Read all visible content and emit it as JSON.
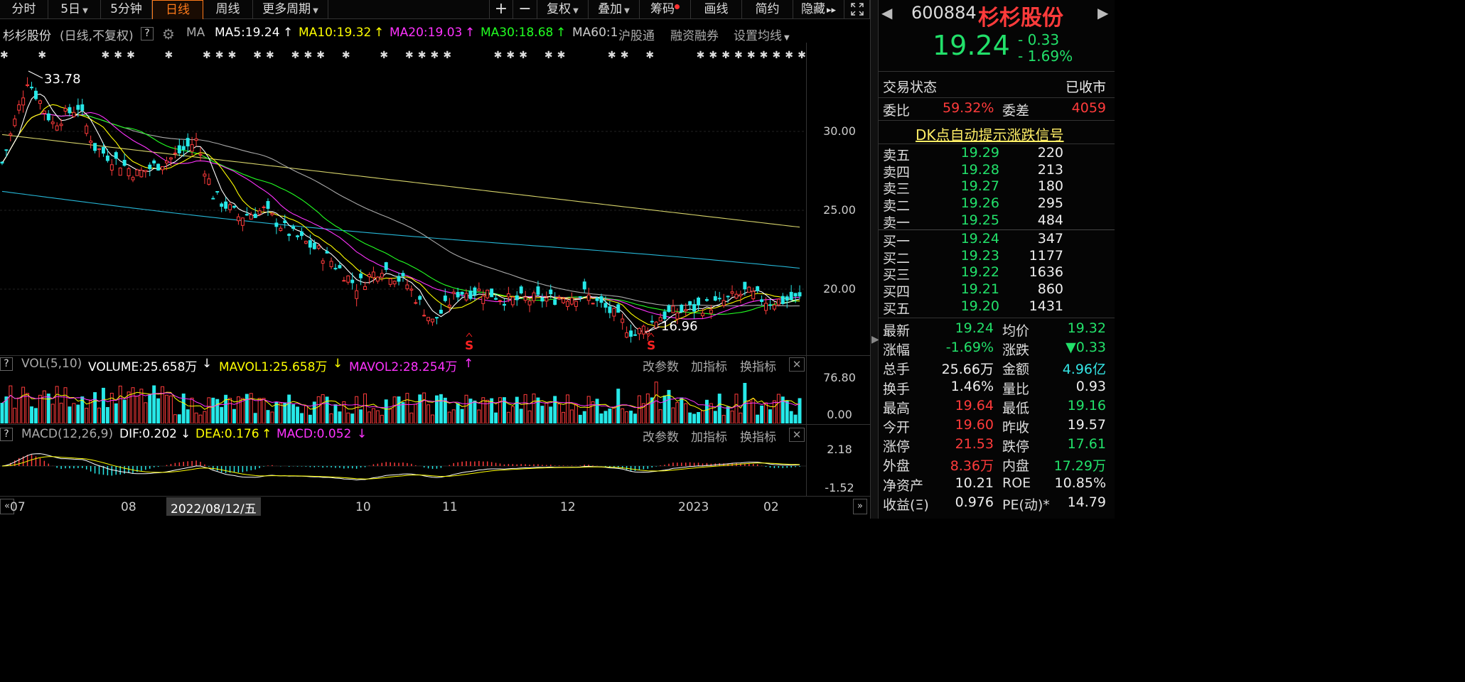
{
  "toolbar": {
    "tabs": [
      {
        "label": "分时"
      },
      {
        "label": "5日"
      },
      {
        "label": "5分钟"
      },
      {
        "label": "日线"
      },
      {
        "label": "周线"
      },
      {
        "label": "更多周期"
      }
    ],
    "right": [
      {
        "label": "+"
      },
      {
        "label": "−"
      },
      {
        "label": "复权"
      },
      {
        "label": "叠加"
      },
      {
        "label": "筹码"
      },
      {
        "label": "画线"
      },
      {
        "label": "简约"
      },
      {
        "label": "隐藏"
      }
    ]
  },
  "main_header": {
    "stock_name": "杉杉股份",
    "mode": "(日线,不复权)",
    "q": "?",
    "ma_label": "MA",
    "ma5": "MA5:19.24",
    "ma10": "MA10:19.32",
    "ma20": "MA20:19.03",
    "ma30": "MA30:18.68",
    "ma60": "MA60:1",
    "hgt": "沪股通",
    "rzrq": "融资融券",
    "set_ma": "设置均线"
  },
  "price_axis": [
    "30.00",
    "25.00",
    "20.00"
  ],
  "price_labels": {
    "high": "33.78",
    "low": "16.96",
    "signal": "S"
  },
  "vol_header": {
    "name": "VOL(5,10)",
    "volume": "VOLUME:25.658万",
    "mavol1": "MAVOL1:25.658万",
    "mavol2": "MAVOL2:28.254万"
  },
  "vol_axis": [
    "76.80",
    "0.00"
  ],
  "macd_header": {
    "name": "MACD(12,26,9)",
    "dif": "DIF:0.202",
    "dea": "DEA:0.176",
    "macd": "MACD:0.052"
  },
  "macd_axis": [
    "2.18",
    "-1.52"
  ],
  "panel_btns": {
    "edit": "改参数",
    "add": "加指标",
    "switch": "换指标"
  },
  "date_axis": {
    "labels": [
      "07",
      "08",
      "10",
      "11",
      "12",
      "2023",
      "02"
    ],
    "cursor_date": "2022/08/12/五"
  },
  "quote": {
    "code": "600884",
    "name": "杉杉股份",
    "price": "19.24",
    "change": "- 0.33",
    "pct": "- 1.69%",
    "status_label": "交易状态",
    "status_value": "已收市",
    "webi_label": "委比",
    "webi_value": "59.32%",
    "weicha_label": "委差",
    "weicha_value": "4059",
    "dk_link": "DK点自动提示涨跌信号",
    "asks": [
      {
        "label": "卖五",
        "price": "19.29",
        "vol": "220"
      },
      {
        "label": "卖四",
        "price": "19.28",
        "vol": "213"
      },
      {
        "label": "卖三",
        "price": "19.27",
        "vol": "180"
      },
      {
        "label": "卖二",
        "price": "19.26",
        "vol": "295"
      },
      {
        "label": "卖一",
        "price": "19.25",
        "vol": "484"
      }
    ],
    "bids": [
      {
        "label": "买一",
        "price": "19.24",
        "vol": "347"
      },
      {
        "label": "买二",
        "price": "19.23",
        "vol": "1177"
      },
      {
        "label": "买三",
        "price": "19.22",
        "vol": "1636"
      },
      {
        "label": "买四",
        "price": "19.21",
        "vol": "860"
      },
      {
        "label": "买五",
        "price": "19.20",
        "vol": "1431"
      }
    ],
    "stats": [
      {
        "l1": "最新",
        "v1": "19.24",
        "c1": "grn",
        "l2": "均价",
        "v2": "19.32",
        "c2": "grn"
      },
      {
        "l1": "涨幅",
        "v1": "-1.69%",
        "c1": "grn",
        "l2": "涨跌",
        "v2": "▼0.33",
        "c2": "grn"
      },
      {
        "l1": "总手",
        "v1": "25.66万",
        "c1": "wht",
        "l2": "金额",
        "v2": "4.96亿",
        "c2": "cyn"
      },
      {
        "l1": "换手",
        "v1": "1.46%",
        "c1": "wht",
        "l2": "量比",
        "v2": "0.93",
        "c2": "wht"
      },
      {
        "l1": "最高",
        "v1": "19.64",
        "c1": "red",
        "l2": "最低",
        "v2": "19.16",
        "c2": "grn"
      },
      {
        "l1": "今开",
        "v1": "19.60",
        "c1": "red",
        "l2": "昨收",
        "v2": "19.57",
        "c2": "wht"
      },
      {
        "l1": "涨停",
        "v1": "21.53",
        "c1": "red",
        "l2": "跌停",
        "v2": "17.61",
        "c2": "grn"
      },
      {
        "l1": "外盘",
        "v1": "8.36万",
        "c1": "red",
        "l2": "内盘",
        "v2": "17.29万",
        "c2": "grn"
      },
      {
        "l1": "净资产",
        "v1": "10.21",
        "c1": "wht",
        "l2": "ROE",
        "v2": "10.85%",
        "c2": "wht"
      },
      {
        "l1": "收益(Ξ)",
        "v1": "0.976",
        "c1": "wht",
        "l2": "PE(动)*",
        "v2": "14.79",
        "c2": "wht"
      }
    ]
  },
  "colors": {
    "up": "#ff3b3b",
    "down": "#26e8e8",
    "ma5": "#ffffff",
    "ma10": "#ffff00",
    "ma20": "#ff33ff",
    "ma30": "#22ff22",
    "ma60": "#aaaaaa",
    "ma120": "#26b6d6",
    "ma250": "#d6d36a"
  }
}
